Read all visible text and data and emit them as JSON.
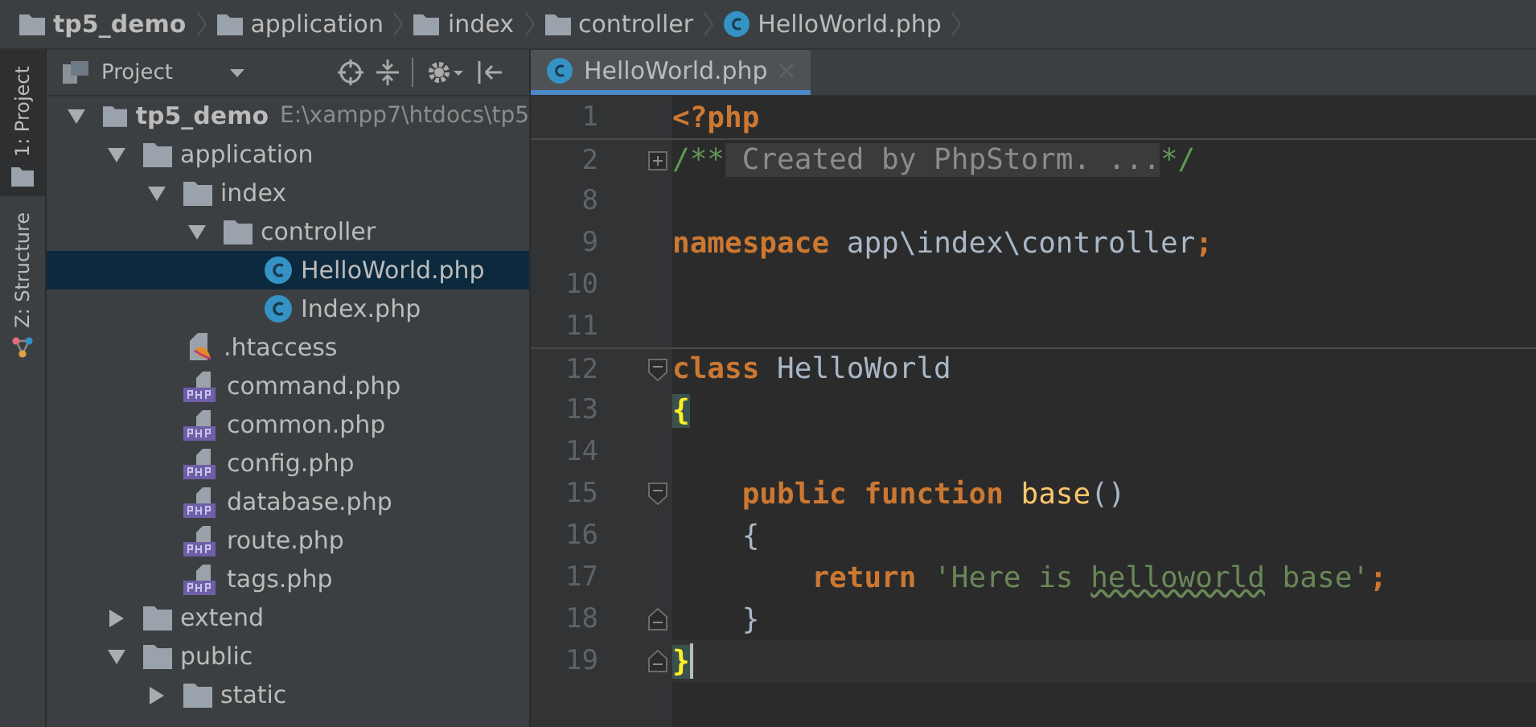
{
  "breadcrumb": [
    {
      "label": "tp5_demo",
      "kind": "folder",
      "bold": true
    },
    {
      "label": "application",
      "kind": "folder",
      "bold": false
    },
    {
      "label": "index",
      "kind": "folder",
      "bold": false
    },
    {
      "label": "controller",
      "kind": "folder",
      "bold": false
    },
    {
      "label": "HelloWorld.php",
      "kind": "php-class",
      "bold": false
    }
  ],
  "tool_strip": [
    {
      "label": "1: Project",
      "kind": "project",
      "selected": true
    },
    {
      "label": "Z: Structure",
      "kind": "structure",
      "selected": false
    }
  ],
  "project_panel": {
    "title": "Project",
    "tree": [
      {
        "label": "tp5_demo",
        "path": "E:\\xampp7\\htdocs\\tp5",
        "kind": "folder",
        "expanded": true,
        "selected": false,
        "children": [
          {
            "label": "application",
            "kind": "folder",
            "expanded": true,
            "selected": false,
            "children": [
              {
                "label": "index",
                "kind": "folder",
                "expanded": true,
                "selected": false,
                "children": [
                  {
                    "label": "controller",
                    "kind": "folder",
                    "expanded": true,
                    "selected": false,
                    "children": [
                      {
                        "label": "HelloWorld.php",
                        "kind": "php-class",
                        "selected": true
                      },
                      {
                        "label": "Index.php",
                        "kind": "php-class",
                        "selected": false
                      }
                    ]
                  }
                ]
              },
              {
                "label": ".htaccess",
                "kind": "htaccess",
                "selected": false
              },
              {
                "label": "command.php",
                "kind": "php-file",
                "selected": false
              },
              {
                "label": "common.php",
                "kind": "php-file",
                "selected": false
              },
              {
                "label": "config.php",
                "kind": "php-file",
                "selected": false
              },
              {
                "label": "database.php",
                "kind": "php-file",
                "selected": false
              },
              {
                "label": "route.php",
                "kind": "php-file",
                "selected": false
              },
              {
                "label": "tags.php",
                "kind": "php-file",
                "selected": false
              }
            ]
          },
          {
            "label": "extend",
            "kind": "folder",
            "expanded": false,
            "selected": false
          },
          {
            "label": "public",
            "kind": "folder",
            "expanded": true,
            "selected": false,
            "children": [
              {
                "label": "static",
                "kind": "folder",
                "expanded": false,
                "selected": false
              }
            ]
          }
        ]
      }
    ]
  },
  "editor": {
    "tabs": [
      {
        "label": "HelloWorld.php",
        "kind": "php-class",
        "selected": true
      }
    ],
    "lines": [
      {
        "number": "1",
        "tokens": [
          {
            "text": "<?php",
            "kind": "keyword"
          }
        ]
      },
      {
        "number": "2",
        "fold": {
          "kind": "expand"
        },
        "separator": true,
        "tokens": [
          {
            "text": "/**",
            "kind": "comment"
          },
          {
            "text": " Created by PhpStorm. ...",
            "kind": "folded"
          },
          {
            "text": "*/",
            "kind": "comment"
          }
        ]
      },
      {
        "number": "8"
      },
      {
        "number": "9",
        "tokens": [
          {
            "text": "namespace",
            "kind": "keyword"
          },
          {
            "text": " app\\index\\controller",
            "kind": "plain"
          },
          {
            "text": ";",
            "kind": "punct"
          }
        ]
      },
      {
        "number": "10"
      },
      {
        "number": "11"
      },
      {
        "number": "12",
        "fold": {
          "kind": "collapse-start"
        },
        "separator": true,
        "tokens": [
          {
            "text": "class",
            "kind": "keyword"
          },
          {
            "text": " HelloWorld",
            "kind": "plain"
          }
        ]
      },
      {
        "number": "13",
        "tokens": [
          {
            "text": "{",
            "kind": "brace-match"
          }
        ]
      },
      {
        "number": "14"
      },
      {
        "number": "15",
        "fold": {
          "kind": "collapse-start"
        },
        "tokens": [
          {
            "text": "    public function",
            "kind": "keyword"
          },
          {
            "text": " base",
            "kind": "function"
          },
          {
            "text": "()",
            "kind": "plain"
          }
        ]
      },
      {
        "number": "16",
        "tokens": [
          {
            "text": "    {",
            "kind": "plain"
          }
        ]
      },
      {
        "number": "17",
        "tokens": [
          {
            "text": "        return",
            "kind": "keyword"
          },
          {
            "text": " 'Here is ",
            "kind": "string"
          },
          {
            "text": "helloworld",
            "kind": "string-typo"
          },
          {
            "text": " base'",
            "kind": "string"
          },
          {
            "text": ";",
            "kind": "punct"
          }
        ]
      },
      {
        "number": "18",
        "fold": {
          "kind": "collapse-end"
        },
        "tokens": [
          {
            "text": "    }",
            "kind": "plain"
          }
        ]
      },
      {
        "number": "19",
        "fold": {
          "kind": "collapse-end"
        },
        "current": true,
        "tokens": [
          {
            "text": "}",
            "kind": "brace-match"
          }
        ]
      }
    ]
  }
}
